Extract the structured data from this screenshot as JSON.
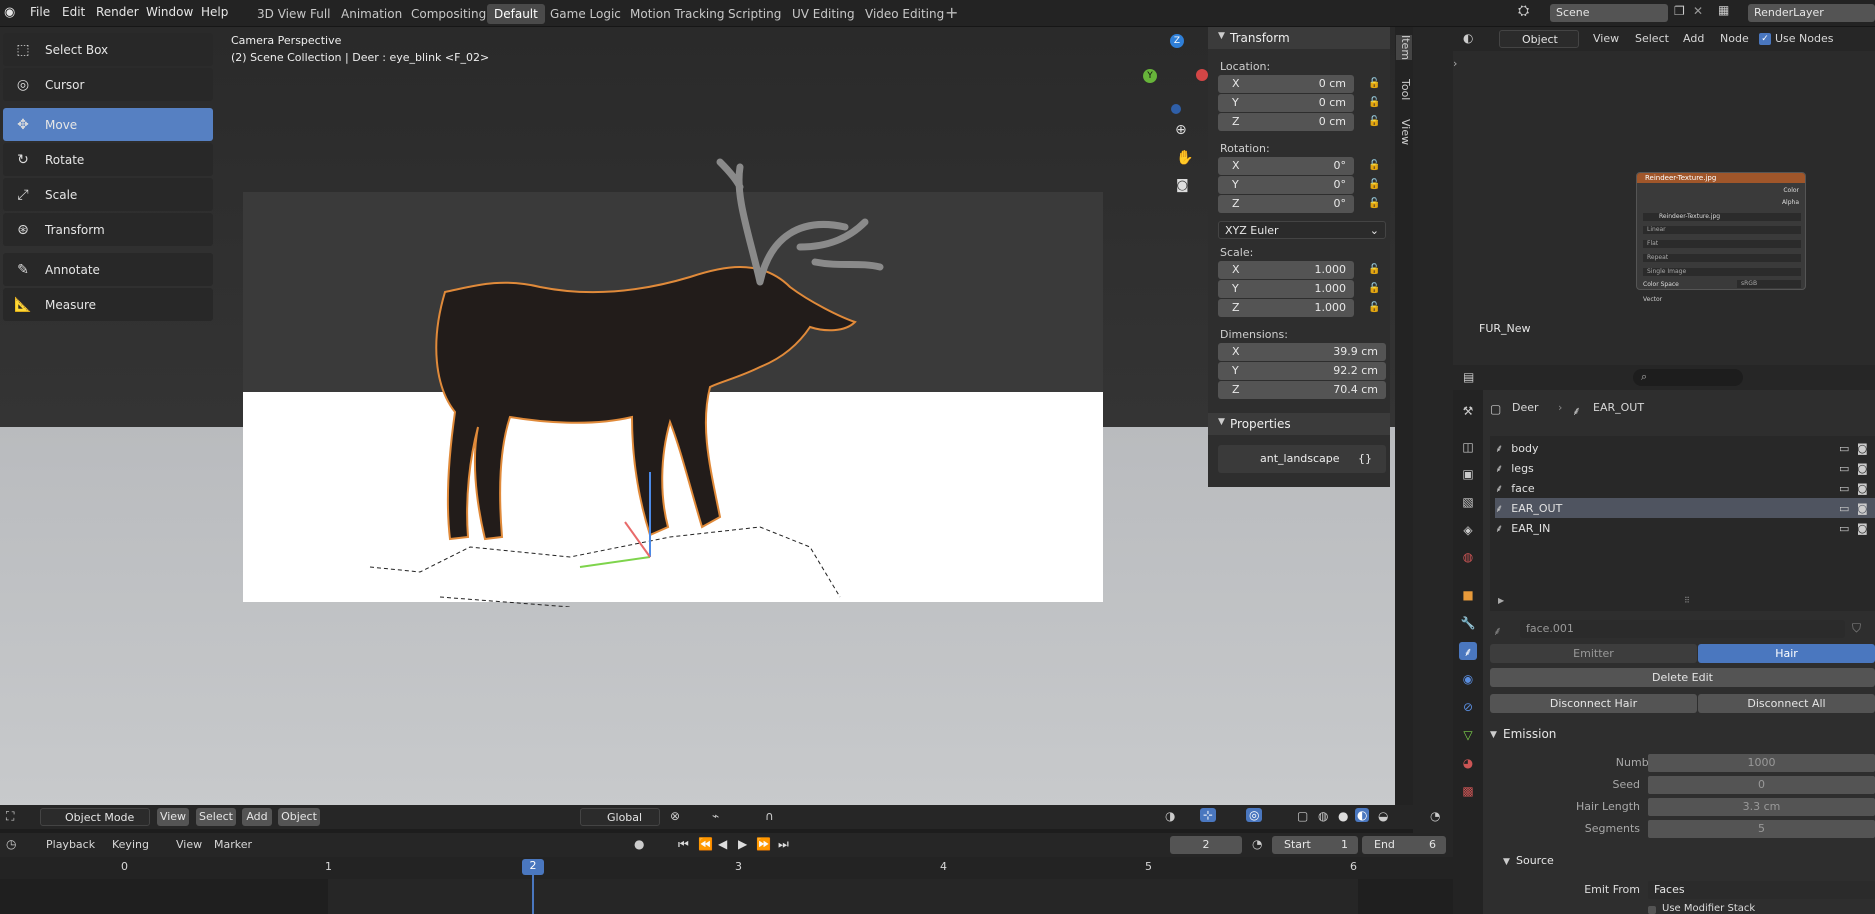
{
  "menu": [
    "File",
    "Edit",
    "Render",
    "Window",
    "Help"
  ],
  "workspaces": [
    "3D View Full",
    "Animation",
    "Compositing",
    "Default",
    "Game Logic",
    "Motion Tracking",
    "Scripting",
    "UV Editing",
    "Video Editing"
  ],
  "active_workspace": "Default",
  "scene_name": "Scene",
  "render_layer": "RenderLayer",
  "viewport": {
    "title": "Camera Perspective",
    "subtitle": "(2) Scene Collection | Deer : eye_blink <F_02>",
    "mode": "Object Mode",
    "header_menus": [
      "View",
      "Select",
      "Add",
      "Object"
    ],
    "orientation": "Global"
  },
  "tools": [
    {
      "label": "Select Box",
      "icon": "select-box-icon"
    },
    {
      "label": "Cursor",
      "icon": "cursor-icon"
    },
    {
      "label": "Move",
      "icon": "move-icon"
    },
    {
      "label": "Rotate",
      "icon": "rotate-icon"
    },
    {
      "label": "Scale",
      "icon": "scale-icon"
    },
    {
      "label": "Transform",
      "icon": "transform-icon"
    },
    {
      "label": "Annotate",
      "icon": "annotate-icon"
    },
    {
      "label": "Measure",
      "icon": "measure-icon"
    }
  ],
  "transform": {
    "header": "Transform",
    "location_label": "Location:",
    "location": {
      "x": "0 cm",
      "y": "0 cm",
      "z": "0 cm"
    },
    "rotation_label": "Rotation:",
    "rotation": {
      "x": "0°",
      "y": "0°",
      "z": "0°"
    },
    "rotation_mode": "XYZ Euler",
    "scale_label": "Scale:",
    "scale": {
      "x": "1.000",
      "y": "1.000",
      "z": "1.000"
    },
    "dimensions_label": "Dimensions:",
    "dimensions": {
      "x": "39.9 cm",
      "y": "92.2 cm",
      "z": "70.4 cm"
    },
    "axes": {
      "x": "X",
      "y": "Y",
      "z": "Z"
    }
  },
  "properties": {
    "header": "Properties",
    "item": "ant_landscape",
    "item_icon": "{}"
  },
  "sidebar_tabs": [
    "Item",
    "Tool",
    "View"
  ],
  "node_editor": {
    "object_menu": "Object",
    "menus": [
      "View",
      "Select",
      "Add",
      "Node"
    ],
    "use_nodes_label": "Use Nodes",
    "fur_label": "FUR_New",
    "node": {
      "title": "Reindeer-Texture.jpg",
      "outputs": [
        "Color",
        "Alpha"
      ],
      "image_name": "Reindeer-Texture.jpg",
      "users": "2",
      "interpolation": "Linear",
      "projection": "Flat",
      "extension": "Repeat",
      "source": "Single Image",
      "colorspace_label": "Color Space",
      "colorspace": "sRGB",
      "input": "Vector"
    }
  },
  "outliner": {
    "breadcrumb": [
      "Deer",
      "EAR_OUT"
    ],
    "items": [
      "body",
      "legs",
      "face",
      "EAR_OUT",
      "EAR_IN"
    ],
    "selected": "EAR_OUT"
  },
  "particles": {
    "name": "face.001",
    "type_options": [
      "Emitter",
      "Hair"
    ],
    "type_selected": "Hair",
    "delete_edit": "Delete Edit",
    "disconnect_hair": "Disconnect Hair",
    "disconnect_all": "Disconnect All",
    "emission_header": "Emission",
    "emission": [
      {
        "label": "Number",
        "value": "1000"
      },
      {
        "label": "Seed",
        "value": "0"
      },
      {
        "label": "Hair Length",
        "value": "3.3 cm"
      },
      {
        "label": "Segments",
        "value": "5"
      }
    ],
    "source_header": "Source",
    "emit_from_label": "Emit From",
    "emit_from": "Faces",
    "use_modifier_stack": "Use Modifier Stack"
  },
  "timeline": {
    "menus": [
      "Playback",
      "Keying",
      "View",
      "Marker"
    ],
    "current_frame": "2",
    "start_label": "Start",
    "start": "1",
    "end_label": "End",
    "end": "6",
    "ruler": [
      "0",
      "1",
      "2",
      "3",
      "4",
      "5",
      "6"
    ]
  }
}
